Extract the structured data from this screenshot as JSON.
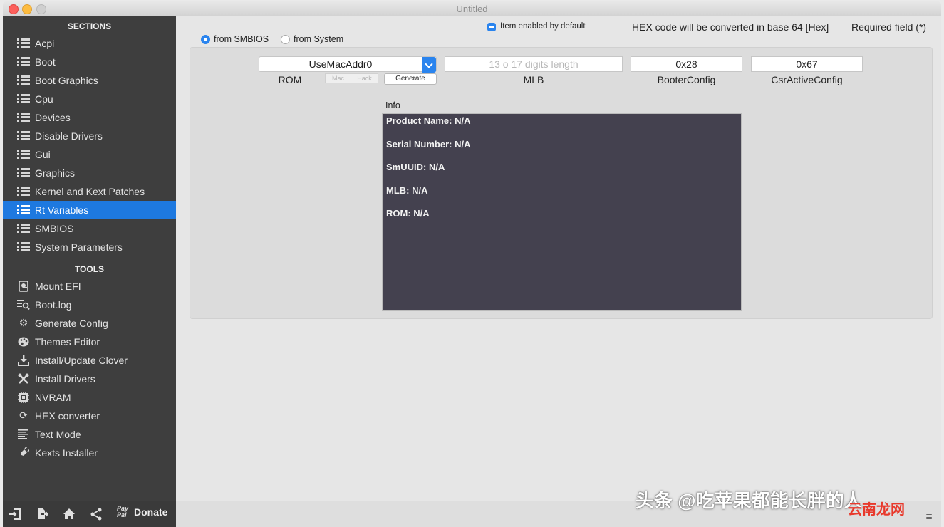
{
  "window": {
    "title": "Untitled"
  },
  "sidebar": {
    "sections_heading": "SECTIONS",
    "sections": [
      {
        "label": "Acpi",
        "icon": "list-icon"
      },
      {
        "label": "Boot",
        "icon": "list-icon"
      },
      {
        "label": "Boot Graphics",
        "icon": "list-icon"
      },
      {
        "label": "Cpu",
        "icon": "list-icon"
      },
      {
        "label": "Devices",
        "icon": "list-icon"
      },
      {
        "label": "Disable Drivers",
        "icon": "list-icon"
      },
      {
        "label": "Gui",
        "icon": "list-icon"
      },
      {
        "label": "Graphics",
        "icon": "list-icon"
      },
      {
        "label": "Kernel and Kext Patches",
        "icon": "list-icon"
      },
      {
        "label": "Rt Variables",
        "icon": "list-icon",
        "active": true
      },
      {
        "label": "SMBIOS",
        "icon": "list-icon"
      },
      {
        "label": "System Parameters",
        "icon": "list-icon"
      }
    ],
    "tools_heading": "TOOLS",
    "tools": [
      {
        "label": "Mount EFI",
        "icon": "disk-icon"
      },
      {
        "label": "Boot.log",
        "icon": "log-search-icon"
      },
      {
        "label": "Generate Config",
        "icon": "gears-icon"
      },
      {
        "label": "Themes Editor",
        "icon": "palette-icon"
      },
      {
        "label": "Install/Update Clover",
        "icon": "download-icon"
      },
      {
        "label": "Install Drivers",
        "icon": "tools-icon"
      },
      {
        "label": "NVRAM",
        "icon": "chip-icon"
      },
      {
        "label": "HEX converter",
        "icon": "refresh-icon"
      },
      {
        "label": "Text Mode",
        "icon": "text-lines-icon"
      },
      {
        "label": "Kexts Installer",
        "icon": "plug-icon"
      }
    ],
    "bottom": {
      "paypal_text": "Pay Pal",
      "donate_label": "Donate"
    }
  },
  "main": {
    "radio_smbios": "from SMBIOS",
    "radio_system": "from System",
    "item_enabled_label": "Item enabled by default",
    "hex_note": "HEX code will be converted in base 64 [Hex]",
    "required_note": "Required field (*)",
    "rom": {
      "value": "UseMacAddr0",
      "caption": "ROM",
      "seg_mac": "Mac",
      "seg_hack": "Hack",
      "generate": "Generate"
    },
    "mlb": {
      "placeholder": "13 o 17 digits length",
      "caption": "MLB"
    },
    "booter": {
      "value": "0x28",
      "caption": "BooterConfig"
    },
    "csr": {
      "value": "0x67",
      "caption": "CsrActiveConfig"
    },
    "info": {
      "label": "Info",
      "lines": [
        "Product Name: N/A",
        "Serial Number: N/A",
        "SmUUID: N/A",
        "MLB: N/A",
        "ROM: N/A"
      ]
    }
  },
  "watermark": {
    "text": "头条 @吃苹果都能长胖的人",
    "site": "云南龙网"
  },
  "colors": {
    "accent": "#1e79e0",
    "sidebar_bg": "#3e3e3e",
    "info_bg": "#44414f"
  }
}
